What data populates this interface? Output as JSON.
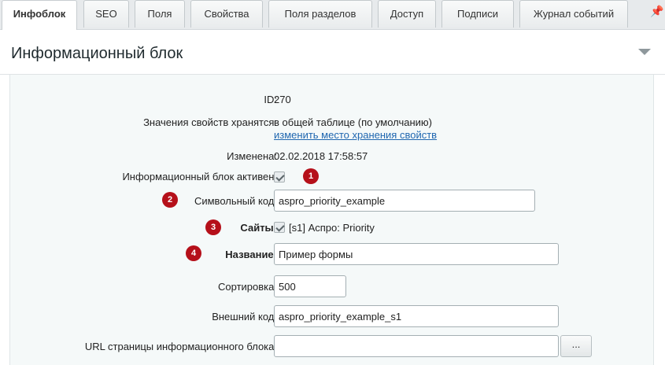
{
  "tabs": [
    {
      "label": "Инфоблок",
      "active": true
    },
    {
      "label": "SEO"
    },
    {
      "label": "Поля"
    },
    {
      "label": "Свойства"
    },
    {
      "label": "Поля разделов"
    },
    {
      "label": "Доступ"
    },
    {
      "label": "Подписи"
    },
    {
      "label": "Журнал событий"
    }
  ],
  "pin_icon": "pin-icon",
  "panel": {
    "title": "Информационный блок",
    "collapse_icon": "triangle-down-icon"
  },
  "form": {
    "id": {
      "label": "ID:",
      "value": "270"
    },
    "storage": {
      "label": "Значения свойств хранятся:",
      "value": "в общей таблице (по умолчанию)",
      "link": "изменить место хранения свойств"
    },
    "modified": {
      "label": "Изменена:",
      "value": "02.02.2018 17:58:57"
    },
    "active": {
      "label": "Информационный блок активен:",
      "checked": true
    },
    "code": {
      "label": "Символьный код:",
      "value": "aspro_priority_example"
    },
    "sites": {
      "label": "Сайты:",
      "checked": true,
      "site_label": "[s1] Аспро: Priority"
    },
    "name": {
      "label": "Название:",
      "value": "Пример формы"
    },
    "sort": {
      "label": "Сортировка:",
      "value": "500"
    },
    "external_code": {
      "label": "Внешний код:",
      "value": "aspro_priority_example_s1"
    },
    "url": {
      "label": "URL страницы информационного блока:",
      "value": "",
      "button": "..."
    }
  },
  "badges": [
    "1",
    "2",
    "3",
    "4"
  ],
  "colors": {
    "badge": "#b5101a",
    "link": "#2067b0",
    "panel_bg": "#f5f9f9"
  }
}
